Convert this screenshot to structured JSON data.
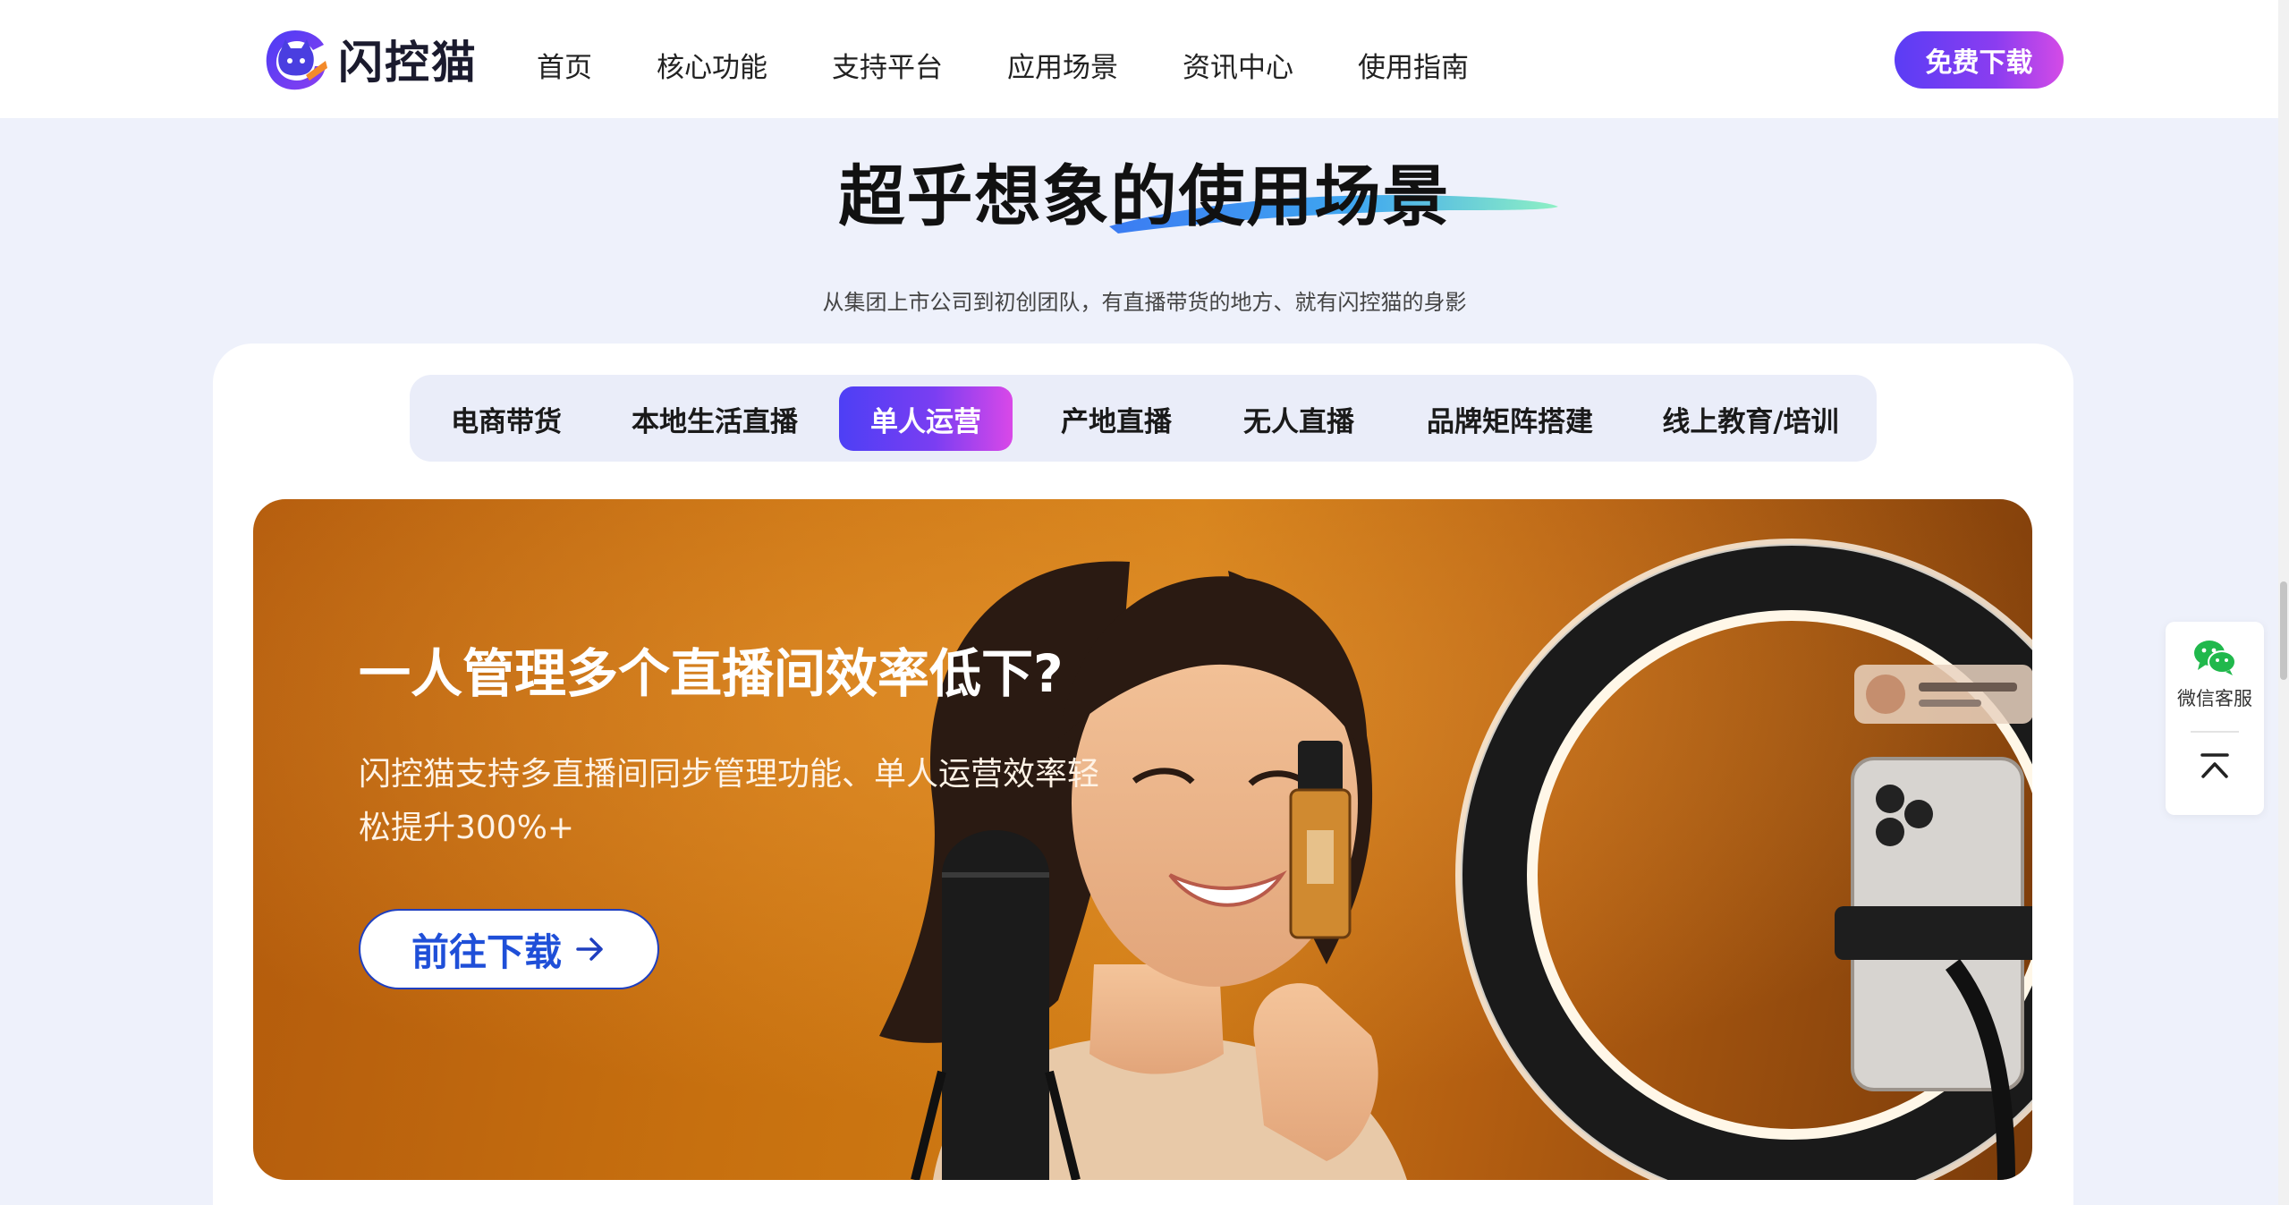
{
  "header": {
    "brand": "闪控猫",
    "nav": [
      "首页",
      "核心功能",
      "支持平台",
      "应用场景",
      "资讯中心",
      "使用指南"
    ],
    "download_label": "免费下载"
  },
  "section": {
    "title": "超乎想象的使用场景",
    "subtitle": "从集团上市公司到初创团队，有直播带货的地方、就有闪控猫的身影"
  },
  "tabs": {
    "items": [
      "电商带货",
      "本地生活直播",
      "单人运营",
      "产地直播",
      "无人直播",
      "品牌矩阵搭建",
      "线上教育/培训"
    ],
    "active_index": 2
  },
  "hero": {
    "title": "一人管理多个直播间效率低下?",
    "desc": "闪控猫支持多直播间同步管理功能、单人运营效率轻松提升300%+",
    "button_label": "前往下载"
  },
  "side_widget": {
    "wechat_label": "微信客服"
  },
  "colors": {
    "brand_purple": "#5a3df5",
    "brand_pink": "#d44be6",
    "button_blue": "#1f4fd8",
    "hero_orange": "#c7700f"
  },
  "icons": [
    "cat-logo-icon",
    "arrow-right-icon",
    "wechat-icon",
    "back-to-top-icon"
  ]
}
